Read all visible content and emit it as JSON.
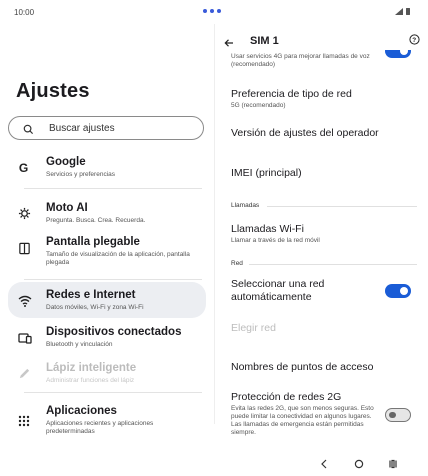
{
  "status": {
    "time": "10:00"
  },
  "left": {
    "title": "Ajustes",
    "search_placeholder": "Buscar ajustes",
    "items": [
      {
        "title": "Google",
        "sub": "Servicios y preferencias",
        "icon": "google-icon"
      },
      {
        "title": "Moto AI",
        "sub": "Pregunta. Busca. Crea. Recuerda.",
        "icon": "moto-ai-icon"
      },
      {
        "title": "Pantalla plegable",
        "sub": "Tamaño de visualización de la aplicación, pantalla plegada",
        "icon": "foldable-icon"
      },
      {
        "title": "Redes e Internet",
        "sub": "Datos móviles, Wi-Fi y zona Wi-Fi",
        "icon": "wifi-icon"
      },
      {
        "title": "Dispositivos conectados",
        "sub": "Bluetooth y vinculación",
        "icon": "connected-devices-icon"
      },
      {
        "title": "Lápiz inteligente",
        "sub": "Administrar funciones del lápiz",
        "icon": "pen-icon"
      },
      {
        "title": "Aplicaciones",
        "sub": "Aplicaciones recientes y aplicaciones predeterminadas",
        "icon": "apps-grid-icon"
      }
    ]
  },
  "right": {
    "title": "SIM 1",
    "top_partial": "Usar servicios 4G para mejorar llamadas de voz (recomendado)",
    "pref_title": "Preferencia de tipo de red",
    "pref_sub": "5G (recomendado)",
    "operator": "Versión de ajustes del operador",
    "imei": "IMEI (principal)",
    "calls_header": "Llamadas",
    "wifi_calls_title": "Llamadas Wi-Fi",
    "wifi_calls_sub": "Llamar a través de la red móvil",
    "net_header": "Red",
    "select_net": "Seleccionar una red automáticamente",
    "choose_net": "Elegir red",
    "apn": "Nombres de puntos de acceso",
    "protect_title": "Protección de redes 2G",
    "protect_sub": "Evita las redes 2G, que son menos seguras. Esto puede limitar la conectividad en algunos lugares. Las llamadas de emergencia están permitidas siempre."
  },
  "toggles": {
    "volte": true,
    "auto_network": true,
    "protect_2g": false
  },
  "colors": {
    "accent": "#1a5cd6",
    "selected_bg": "#eceef2"
  }
}
